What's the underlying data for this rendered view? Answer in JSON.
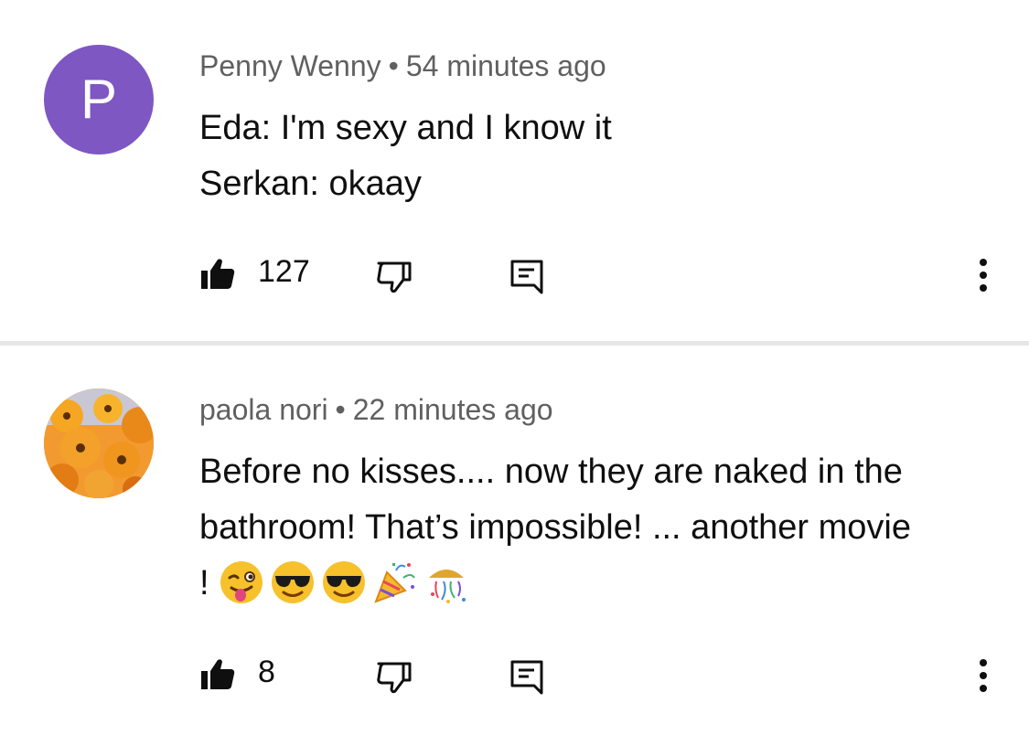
{
  "comments": [
    {
      "avatar_letter": "P",
      "avatar_color": "#7e57c2",
      "author": "Penny Wenny",
      "separator": "•",
      "time": "54 minutes ago",
      "lines": [
        "Eda: I'm sexy and I know it",
        "Serkan: okaay"
      ],
      "likes": "127"
    },
    {
      "avatar_image": "orange-flowers-photo",
      "author": "paola nori",
      "separator": "•",
      "time": "22 minutes ago",
      "lines": [
        "Before no kisses.... now they are naked in the",
        "bathroom! That’s impossible! ... another movie",
        "!"
      ],
      "emojis": [
        "winking-tongue-emoji",
        "sunglasses-emoji",
        "sunglasses-emoji",
        "party-popper-emoji",
        "confetti-ball-emoji"
      ],
      "likes": "8"
    }
  ],
  "icons": {
    "like": "thumbs-up-icon",
    "dislike": "thumbs-down-icon",
    "reply": "reply-comment-icon",
    "more": "more-vertical-icon"
  },
  "colors": {
    "text": "#0f0f0f",
    "meta": "#606060",
    "divider": "#e6e6e6"
  }
}
